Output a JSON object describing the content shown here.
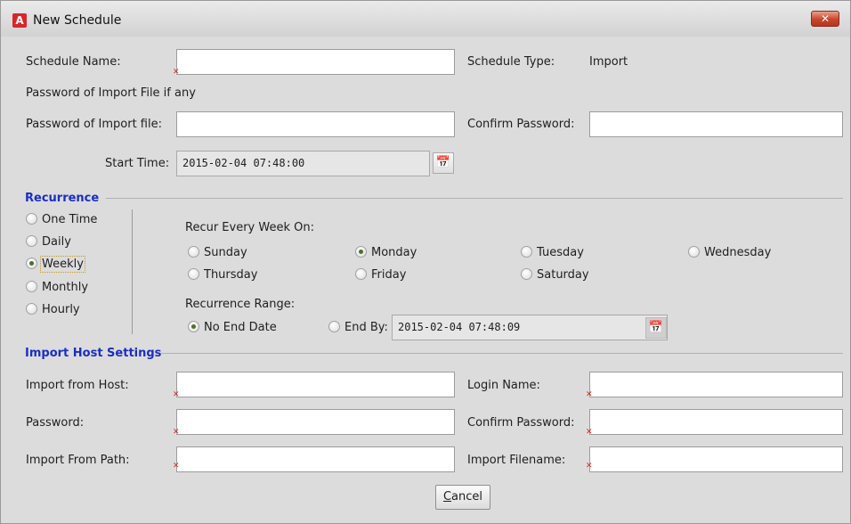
{
  "window": {
    "title": "New Schedule",
    "close_glyph": "✕"
  },
  "form": {
    "schedule_name": {
      "label": "Schedule Name:",
      "value": ""
    },
    "schedule_type": {
      "label": "Schedule Type:",
      "value": "Import"
    },
    "password_note": "Password of Import File if any",
    "import_password": {
      "label": "Password of Import file:",
      "value": ""
    },
    "confirm_import_password": {
      "label": "Confirm Password:",
      "value": ""
    },
    "start_time": {
      "label": "Start Time:",
      "value": "2015-02-04 07:48:00"
    }
  },
  "recurrence": {
    "title": "Recurrence",
    "types": [
      {
        "label": "One Time",
        "checked": false
      },
      {
        "label": "Daily",
        "checked": false
      },
      {
        "label": "Weekly",
        "checked": true
      },
      {
        "label": "Monthly",
        "checked": false
      },
      {
        "label": "Hourly",
        "checked": false
      }
    ],
    "recur_every_label": "Recur Every Week On:",
    "days": [
      {
        "label": "Sunday",
        "checked": false
      },
      {
        "label": "Monday",
        "checked": true
      },
      {
        "label": "Tuesday",
        "checked": false
      },
      {
        "label": "Wednesday",
        "checked": false
      },
      {
        "label": "Thursday",
        "checked": false
      },
      {
        "label": "Friday",
        "checked": false
      },
      {
        "label": "Saturday",
        "checked": false
      }
    ],
    "range_label": "Recurrence Range:",
    "no_end_date": {
      "label": "No End Date",
      "checked": true
    },
    "end_by": {
      "label": "End By:",
      "checked": false,
      "value": "2015-02-04 07:48:09"
    }
  },
  "import_host": {
    "title": "Import Host Settings",
    "host": {
      "label": "Import from Host:",
      "value": ""
    },
    "login": {
      "label": "Login Name:",
      "value": ""
    },
    "password": {
      "label": "Password:",
      "value": ""
    },
    "confirm_password": {
      "label": "Confirm Password:",
      "value": ""
    },
    "path": {
      "label": "Import From Path:",
      "value": ""
    },
    "filename": {
      "label": "Import Filename:",
      "value": ""
    }
  },
  "buttons": {
    "cancel_prefix": "C",
    "cancel_rest": "ancel"
  },
  "icons": {
    "calendar": "📅",
    "required": "✕"
  },
  "colors": {
    "section_title": "#1a2ec4",
    "required_mark": "#d02828",
    "close_button": "#c8452c"
  }
}
